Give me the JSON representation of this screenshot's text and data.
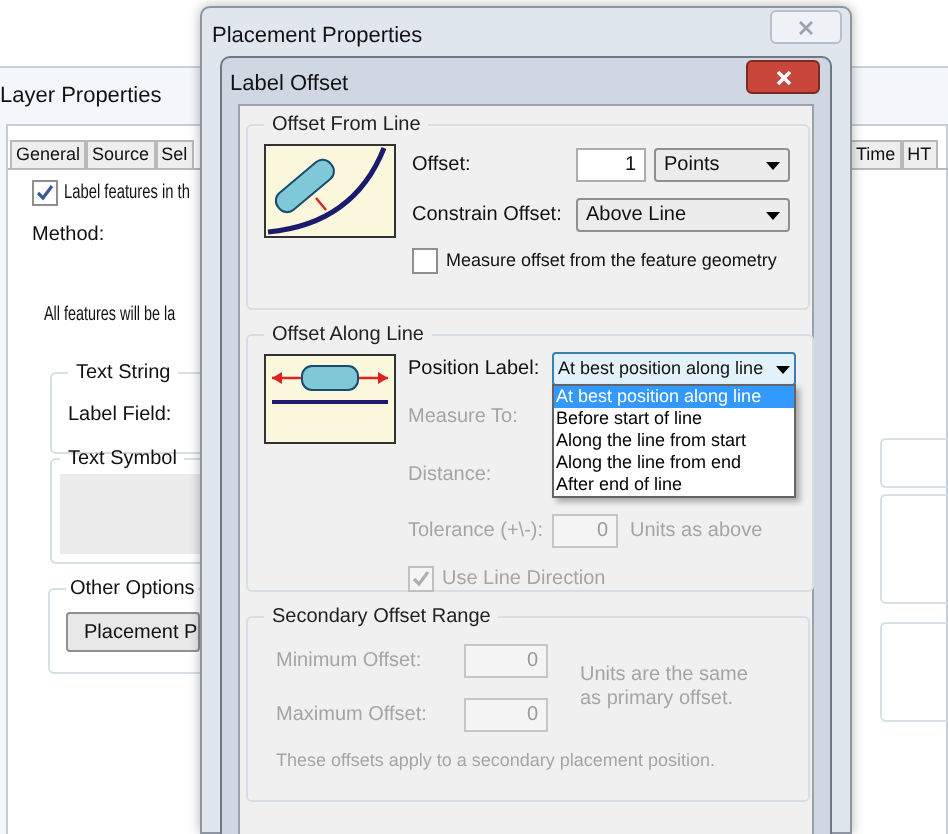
{
  "layer_properties": {
    "title": "Layer Properties",
    "tabs_left": [
      {
        "label": "General",
        "selected": false
      },
      {
        "label": "Source",
        "selected": false
      },
      {
        "label": "Sel",
        "selected": false
      }
    ],
    "tabs_right": [
      {
        "label": "Time",
        "selected": false
      },
      {
        "label": "HT",
        "selected": false
      }
    ],
    "label_features": {
      "label": "Label features in th",
      "checked": true
    },
    "method_label": "Method:",
    "info_text": "All features will be la",
    "text_string": {
      "title": "Text String",
      "label_field": "Label Field:"
    },
    "text_symbol": {
      "title": "Text Symbol"
    },
    "other_options": {
      "title": "Other Options",
      "button": "Placement P"
    }
  },
  "placement_properties": {
    "title": "Placement Properties"
  },
  "label_offset": {
    "title": "Label Offset",
    "offset_from_line": {
      "title": "Offset From Line",
      "offset_label": "Offset:",
      "offset_value": "1",
      "units": "Points",
      "constrain_label": "Constrain Offset:",
      "constrain_value": "Above Line",
      "measure": {
        "label": "Measure offset from the feature geometry",
        "checked": false
      }
    },
    "offset_along_line": {
      "title": "Offset Along Line",
      "position_label": "Position Label:",
      "position_value": "At best position along line",
      "options": [
        {
          "label": "At best position along line",
          "selected": true
        },
        {
          "label": "Before start of line",
          "selected": false
        },
        {
          "label": "Along the line from start",
          "selected": false
        },
        {
          "label": "Along the line from end",
          "selected": false
        },
        {
          "label": "After end of line",
          "selected": false
        }
      ],
      "measure_to": {
        "label": "Measure To:",
        "disabled": true
      },
      "distance": {
        "label": "Distance:",
        "disabled": true
      },
      "tolerance": {
        "label": "Tolerance (+\\-):",
        "value": "0",
        "units": "Units as above",
        "disabled": true
      },
      "use_line_direction": {
        "label": "Use Line Direction",
        "checked": true,
        "disabled": true
      }
    },
    "secondary": {
      "title": "Secondary Offset Range",
      "disabled": true,
      "min_label": "Minimum Offset:",
      "min_value": "0",
      "max_label": "Maximum Offset:",
      "max_value": "0",
      "units_note": "Units are the same as primary offset.",
      "note": "These offsets apply to a secondary placement position."
    }
  }
}
